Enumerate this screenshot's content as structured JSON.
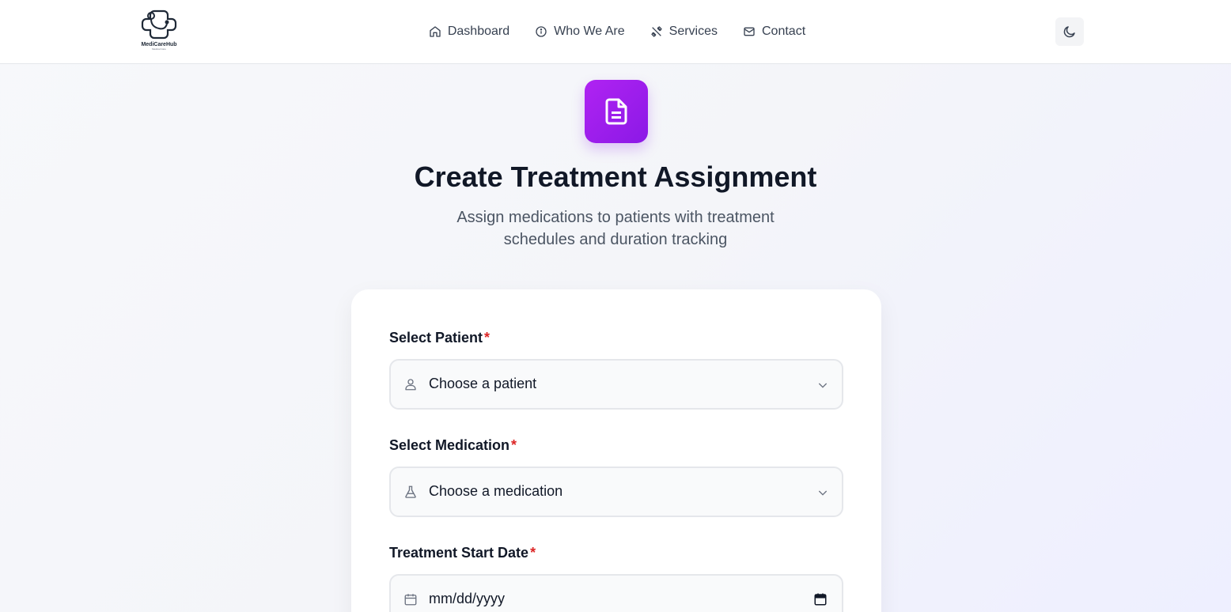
{
  "brand": {
    "name": "MediCareHub",
    "tagline": "Medical Care"
  },
  "nav": {
    "items": [
      {
        "label": "Dashboard",
        "icon": "home-icon"
      },
      {
        "label": "Who We Are",
        "icon": "info-icon"
      },
      {
        "label": "Services",
        "icon": "tools-icon"
      },
      {
        "label": "Contact",
        "icon": "mail-icon"
      }
    ],
    "theme_toggle_icon": "moon-icon"
  },
  "hero": {
    "icon": "document-icon",
    "title": "Create Treatment Assignment",
    "subtitle": "Assign medications to patients with treatment schedules and duration tracking"
  },
  "form": {
    "patient": {
      "label": "Select Patient",
      "required": "*",
      "value": "Choose a patient",
      "icon": "user-icon"
    },
    "medication": {
      "label": "Select Medication",
      "required": "*",
      "value": "Choose a medication",
      "icon": "flask-icon"
    },
    "start_date": {
      "label": "Treatment Start Date",
      "required": "*",
      "value": "mm/dd/yyyy",
      "icon": "calendar-icon"
    }
  },
  "colors": {
    "accent": "#9b1ff0",
    "required": "#dc2626"
  }
}
